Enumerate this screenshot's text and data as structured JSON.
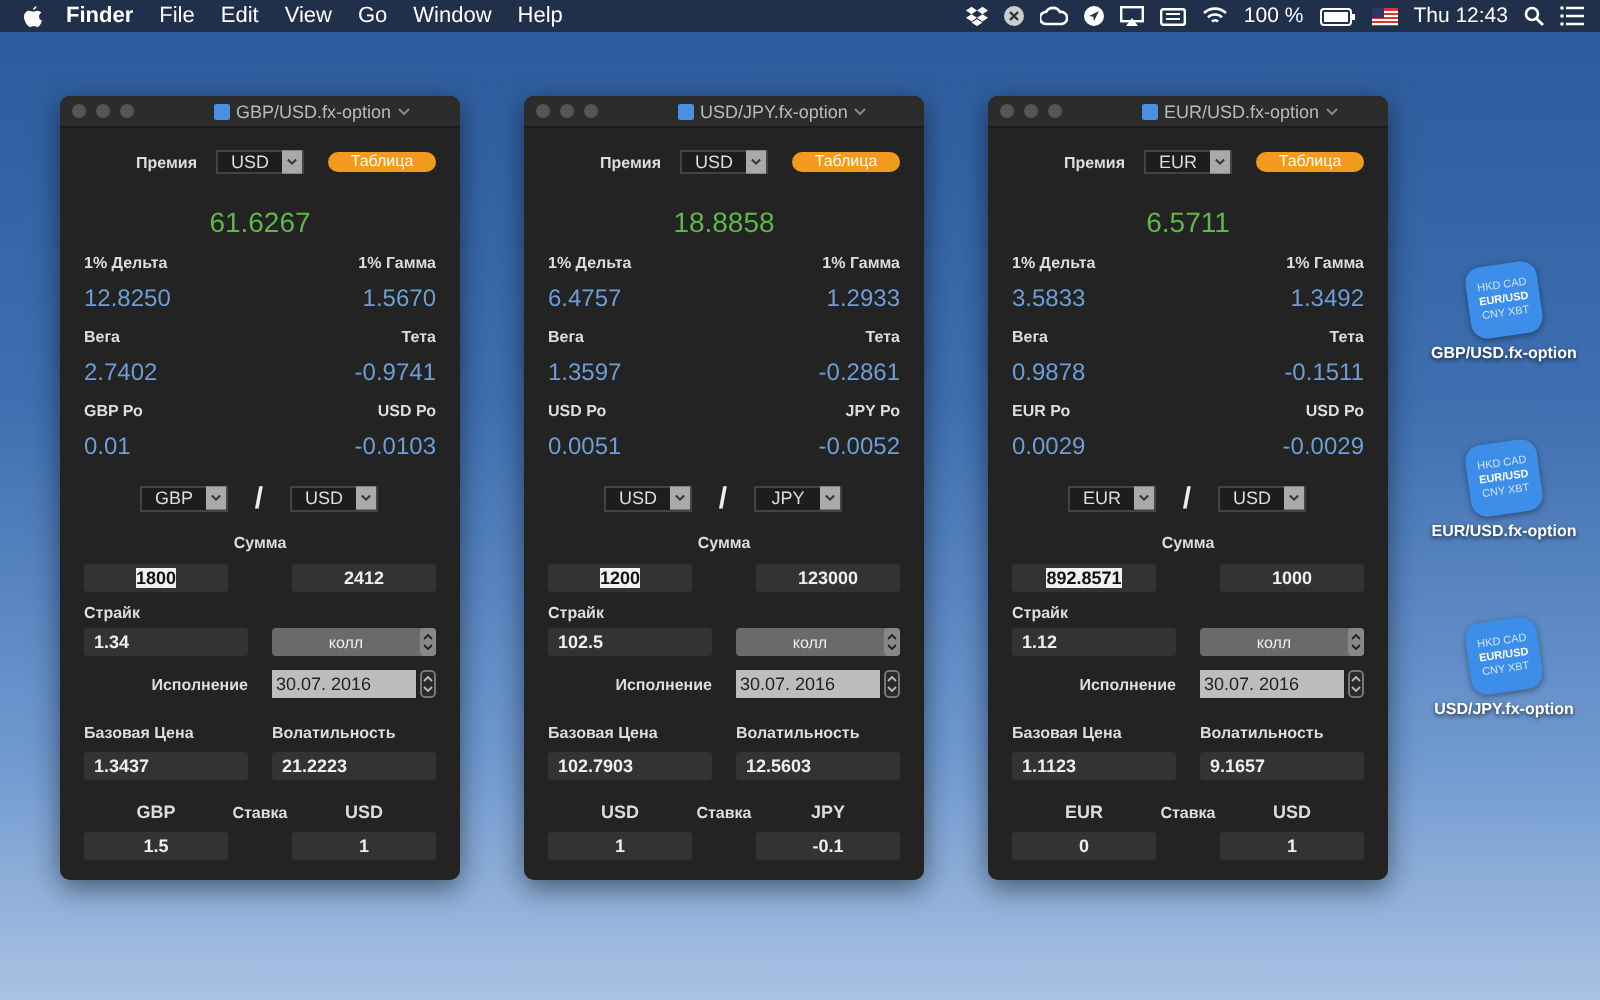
{
  "menu_bar": {
    "app": "Finder",
    "items": [
      "File",
      "Edit",
      "View",
      "Go",
      "Window",
      "Help"
    ],
    "battery_text": "100 %",
    "clock": "Thu 12:43"
  },
  "windows": [
    {
      "title": "GBP/USD.fx-option",
      "premium_label": "Премия",
      "premium_currency": "USD",
      "table_button": "Таблица",
      "premium": "61.6267",
      "greeks": [
        {
          "left_label": "1% Дельта",
          "left_value": "12.8250",
          "right_label": "1% Гамма",
          "right_value": "1.5670"
        },
        {
          "left_label": "Вега",
          "left_value": "2.7402",
          "right_label": "Тета",
          "right_value": "-0.9741"
        },
        {
          "left_label": "GBP Ро",
          "left_value": "0.01",
          "right_label": "USD Ро",
          "right_value": "-0.0103"
        }
      ],
      "pair": {
        "base": "GBP",
        "separator": "/",
        "quote": "USD"
      },
      "amount_label": "Сумма",
      "amounts": [
        {
          "value": "1800",
          "selected": true
        },
        {
          "value": "2412",
          "selected": false
        }
      ],
      "strike_label": "Страйк",
      "strike": "1.34",
      "option_type": "колл",
      "expiry_label": "Исполнение",
      "expiry": "30.07. 2016",
      "spot_label": "Базовая Цена",
      "spot": "1.3437",
      "vol_label": "Волатильность",
      "vol": "21.2223",
      "rate_label": "Ставка",
      "rates": [
        {
          "currency": "GBP",
          "value": "1.5"
        },
        {
          "currency": "USD",
          "value": "1"
        }
      ]
    },
    {
      "title": "USD/JPY.fx-option",
      "premium_label": "Премия",
      "premium_currency": "USD",
      "table_button": "Таблица",
      "premium": "18.8858",
      "greeks": [
        {
          "left_label": "1% Дельта",
          "left_value": "6.4757",
          "right_label": "1% Гамма",
          "right_value": "1.2933"
        },
        {
          "left_label": "Вега",
          "left_value": "1.3597",
          "right_label": "Тета",
          "right_value": "-0.2861"
        },
        {
          "left_label": "USD Ро",
          "left_value": "0.0051",
          "right_label": "JPY Ро",
          "right_value": "-0.0052"
        }
      ],
      "pair": {
        "base": "USD",
        "separator": "/",
        "quote": "JPY"
      },
      "amount_label": "Сумма",
      "amounts": [
        {
          "value": "1200",
          "selected": true
        },
        {
          "value": "123000",
          "selected": false
        }
      ],
      "strike_label": "Страйк",
      "strike": "102.5",
      "option_type": "колл",
      "expiry_label": "Исполнение",
      "expiry": "30.07. 2016",
      "spot_label": "Базовая Цена",
      "spot": "102.7903",
      "vol_label": "Волатильность",
      "vol": "12.5603",
      "rate_label": "Ставка",
      "rates": [
        {
          "currency": "USD",
          "value": "1"
        },
        {
          "currency": "JPY",
          "value": "-0.1"
        }
      ]
    },
    {
      "title": "EUR/USD.fx-option",
      "premium_label": "Премия",
      "premium_currency": "EUR",
      "table_button": "Таблица",
      "premium": "6.5711",
      "greeks": [
        {
          "left_label": "1% Дельта",
          "left_value": "3.5833",
          "right_label": "1% Гамма",
          "right_value": "1.3492"
        },
        {
          "left_label": "Вега",
          "left_value": "0.9878",
          "right_label": "Тета",
          "right_value": "-0.1511"
        },
        {
          "left_label": "EUR Ро",
          "left_value": "0.0029",
          "right_label": "USD Ро",
          "right_value": "-0.0029"
        }
      ],
      "pair": {
        "base": "EUR",
        "separator": "/",
        "quote": "USD"
      },
      "amount_label": "Сумма",
      "amounts": [
        {
          "value": "892.8571",
          "selected": true
        },
        {
          "value": "1000",
          "selected": false
        }
      ],
      "strike_label": "Страйк",
      "strike": "1.12",
      "option_type": "колл",
      "expiry_label": "Исполнение",
      "expiry": "30.07. 2016",
      "spot_label": "Базовая Цена",
      "spot": "1.1123",
      "vol_label": "Волатильность",
      "vol": "9.1657",
      "rate_label": "Ставка",
      "rates": [
        {
          "currency": "EUR",
          "value": "0"
        },
        {
          "currency": "USD",
          "value": "1"
        }
      ]
    }
  ],
  "desktop_icons": [
    {
      "label": "GBP/USD.fx-option",
      "icon_text": [
        "HKD CAD",
        "EUR/USD",
        "CNY XBT"
      ]
    },
    {
      "label": "EUR/USD.fx-option",
      "icon_text": [
        "HKD CAD",
        "EUR/USD",
        "CNY XBT"
      ]
    },
    {
      "label": "USD/JPY.fx-option",
      "icon_text": [
        "HKD CAD",
        "EUR/USD",
        "CNY XBT"
      ]
    }
  ]
}
